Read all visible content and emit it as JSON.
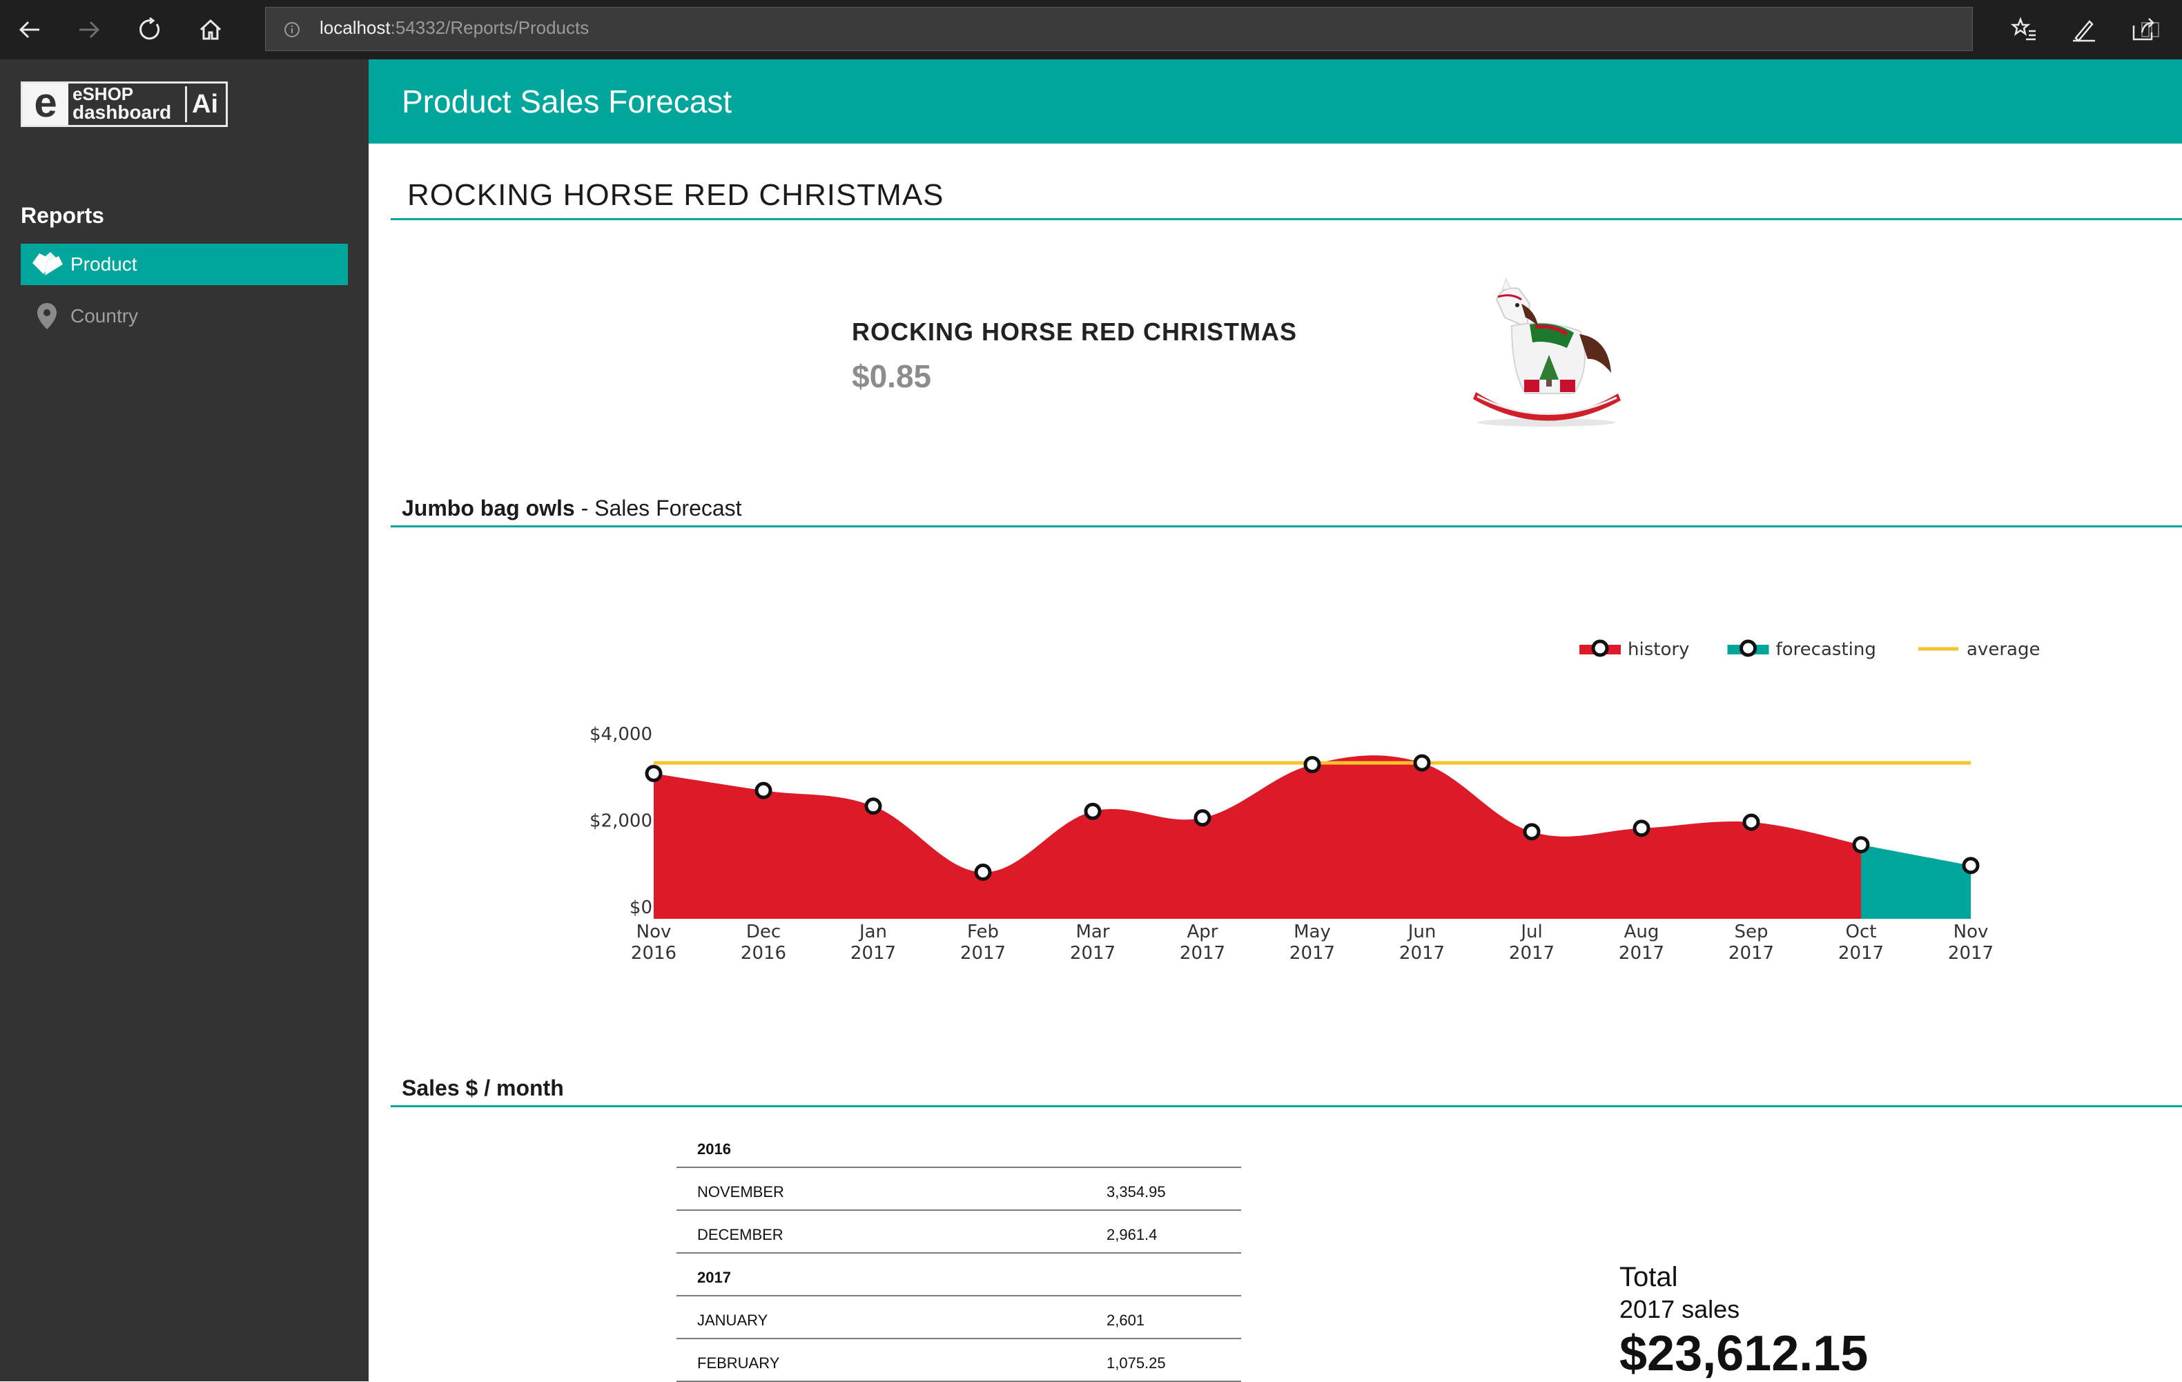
{
  "browser": {
    "url_host": "localhost",
    "url_path": ":54332/Reports/Products"
  },
  "sidebar": {
    "logo": {
      "line1": "eSHOP",
      "line2": "dashboard",
      "badge": "Ai"
    },
    "heading": "Reports",
    "items": [
      {
        "label": "Product",
        "icon": "tag-icon",
        "active": true
      },
      {
        "label": "Country",
        "icon": "map-pin-icon",
        "active": false
      }
    ]
  },
  "header": {
    "title": "Product Sales Forecast"
  },
  "product": {
    "heading": "ROCKING HORSE RED CHRISTMAS",
    "name": "ROCKING HORSE RED CHRISTMAS",
    "price": "$0.85"
  },
  "forecast_section": {
    "title_bold": "Jumbo bag owls",
    "title_rest": " - Sales Forecast"
  },
  "chart_data": {
    "type": "area",
    "x": [
      "Nov 2016",
      "Dec 2016",
      "Jan 2017",
      "Feb 2017",
      "Mar 2017",
      "Apr 2017",
      "May 2017",
      "Jun 2017",
      "Jul 2017",
      "Aug 2017",
      "Sep 2017",
      "Oct 2017",
      "Nov 2017"
    ],
    "x_tick_labels": [
      [
        "Nov",
        "2016"
      ],
      [
        "Dec",
        "2016"
      ],
      [
        "Jan",
        "2017"
      ],
      [
        "Feb",
        "2017"
      ],
      [
        "Mar",
        "2017"
      ],
      [
        "Apr",
        "2017"
      ],
      [
        "May",
        "2017"
      ],
      [
        "Jun",
        "2017"
      ],
      [
        "Jul",
        "2017"
      ],
      [
        "Aug",
        "2017"
      ],
      [
        "Sep",
        "2017"
      ],
      [
        "Oct",
        "2017"
      ],
      [
        "Nov",
        "2017"
      ]
    ],
    "series": [
      {
        "name": "history",
        "color": "#dc1a28",
        "values": [
          3354.95,
          2961.4,
          2601,
          1075.25,
          2480,
          2330,
          3560,
          3600,
          2010,
          2090,
          2230,
          1710,
          null
        ]
      },
      {
        "name": "forecasting",
        "color": "#00a69c",
        "values": [
          null,
          null,
          null,
          null,
          null,
          null,
          null,
          null,
          null,
          null,
          null,
          1710,
          1230
        ]
      },
      {
        "name": "average",
        "color": "#f8c32a",
        "values": [
          3600,
          3600,
          3600,
          3600,
          3600,
          3600,
          3600,
          3600,
          3600,
          3600,
          3600,
          3600,
          3600
        ]
      }
    ],
    "y_ticks": [
      "$0",
      "$2,000",
      "$4,000"
    ],
    "y_tick_values": [
      0,
      2000,
      4000
    ],
    "ylim": [
      0,
      4000
    ],
    "legend_position": "top-right",
    "grid": false
  },
  "sales_section": {
    "title": "Sales $ / month"
  },
  "sales_table": [
    {
      "type": "year",
      "label": "2016",
      "value": ""
    },
    {
      "type": "month",
      "label": "NOVEMBER",
      "value": "3,354.95"
    },
    {
      "type": "month",
      "label": "DECEMBER",
      "value": "2,961.4"
    },
    {
      "type": "year",
      "label": "2017",
      "value": ""
    },
    {
      "type": "month",
      "label": "JANUARY",
      "value": "2,601"
    },
    {
      "type": "month",
      "label": "FEBRUARY",
      "value": "1,075.25"
    }
  ],
  "totals": {
    "label": "Total",
    "sub": "2017 sales",
    "value": "$23,612.15"
  }
}
